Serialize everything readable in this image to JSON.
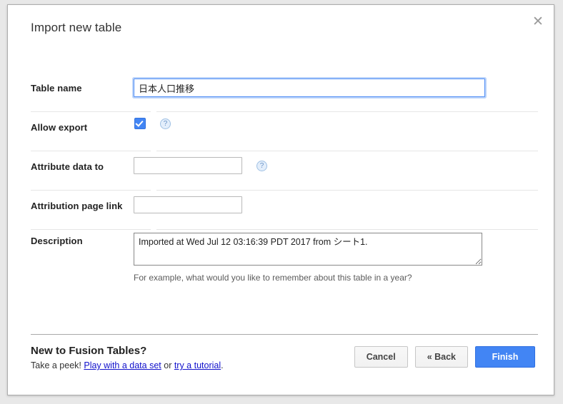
{
  "dialog": {
    "title": "Import new table",
    "close_icon": "close-icon"
  },
  "form": {
    "table_name": {
      "label": "Table name",
      "value": "日本人口推移",
      "placeholder": ""
    },
    "allow_export": {
      "label": "Allow export",
      "checked": true,
      "help_icon": "help-icon",
      "help_glyph": "?"
    },
    "attribute_data_to": {
      "label": "Attribute data to",
      "value": "",
      "placeholder": "",
      "help_icon": "help-icon",
      "help_glyph": "?"
    },
    "attribution_page_link": {
      "label": "Attribution page link",
      "value": "",
      "placeholder": ""
    },
    "description": {
      "label": "Description",
      "value": "Imported at Wed Jul 12 03:16:39 PDT 2017 from シート1.",
      "hint": "For example, what would you like to remember about this table in a year?"
    }
  },
  "footer": {
    "promo_title": "New to Fusion Tables?",
    "promo_prefix": "Take a peek! ",
    "promo_link_1": "Play with a data set",
    "promo_middle": " or ",
    "promo_link_2": "try a tutorial",
    "promo_suffix": ".",
    "cancel_label": "Cancel",
    "back_label": "« Back",
    "finish_label": "Finish"
  },
  "colors": {
    "accent_blue": "#4285f4",
    "link_blue": "#1111cc",
    "focus_border": "#4f8df5",
    "divider": "#e6e6e6",
    "footer_divider": "#a9a9a9"
  }
}
